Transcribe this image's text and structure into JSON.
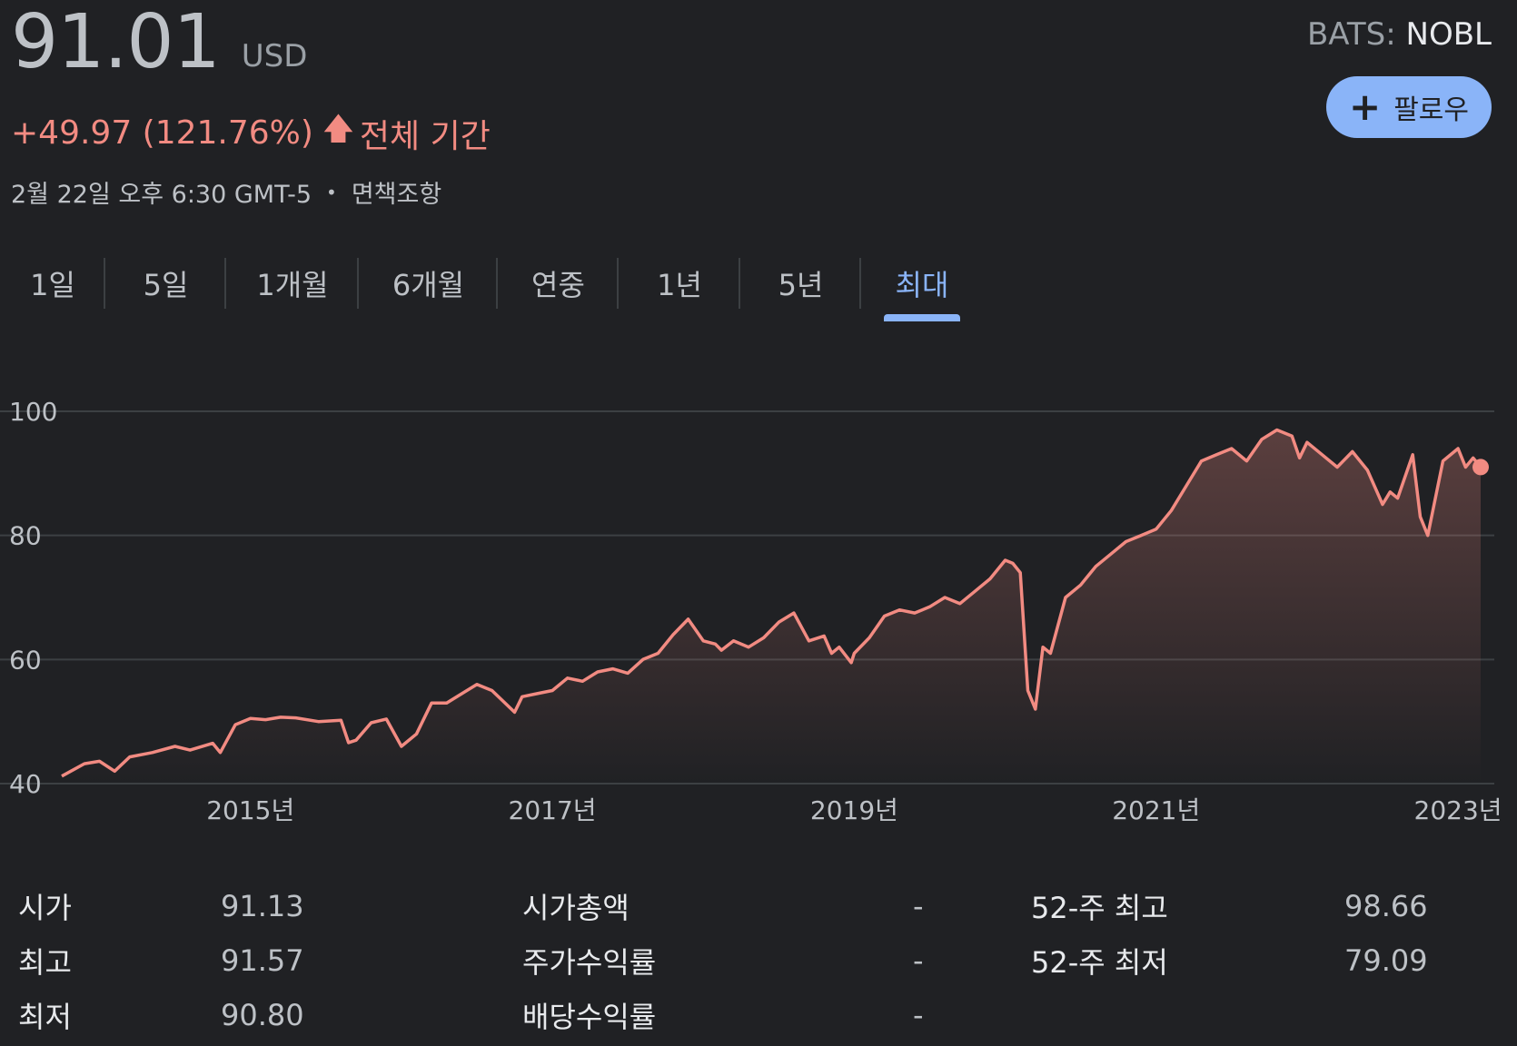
{
  "quote": {
    "price": "91.01",
    "currency": "USD",
    "exchange": "BATS:",
    "symbol": "NOBL",
    "change": "+49.97 (121.76%)",
    "period": "전체 기간",
    "timestamp": "2월 22일 오후 6:30 GMT-5",
    "disclaimer": "면책조항",
    "follow_label": "팔로우",
    "up_color": "#f28b82"
  },
  "tabs": [
    {
      "label": "1일",
      "active": false
    },
    {
      "label": "5일",
      "active": false
    },
    {
      "label": "1개월",
      "active": false
    },
    {
      "label": "6개월",
      "active": false
    },
    {
      "label": "연중",
      "active": false
    },
    {
      "label": "1년",
      "active": false
    },
    {
      "label": "5년",
      "active": false
    },
    {
      "label": "최대",
      "active": true
    }
  ],
  "chart_data": {
    "type": "area",
    "title": "",
    "xlabel": "",
    "ylabel": "",
    "x_ticks": [
      "2015년",
      "2017년",
      "2019년",
      "2021년",
      "2023년"
    ],
    "y_ticks": [
      40,
      60,
      80,
      100
    ],
    "ylim": [
      40,
      100
    ],
    "xlim": [
      2013.75,
      2023.15
    ],
    "grid": true,
    "line_color": "#f28b82",
    "series": [
      {
        "x": [
          2013.75,
          2013.9,
          2014.0,
          2014.1,
          2014.2,
          2014.35,
          2014.5,
          2014.6,
          2014.75,
          2014.8,
          2014.9,
          2015.0,
          2015.1,
          2015.2,
          2015.3,
          2015.45,
          2015.6,
          2015.65,
          2015.7,
          2015.8,
          2015.9,
          2016.0,
          2016.1,
          2016.2,
          2016.3,
          2016.5,
          2016.6,
          2016.75,
          2016.8,
          2016.9,
          2017.0,
          2017.1,
          2017.2,
          2017.3,
          2017.4,
          2017.5,
          2017.6,
          2017.7,
          2017.8,
          2017.9,
          2018.0,
          2018.08,
          2018.12,
          2018.2,
          2018.3,
          2018.4,
          2018.5,
          2018.6,
          2018.7,
          2018.8,
          2018.85,
          2018.9,
          2018.98,
          2019.0,
          2019.1,
          2019.2,
          2019.3,
          2019.4,
          2019.5,
          2019.6,
          2019.7,
          2019.8,
          2019.9,
          2020.0,
          2020.05,
          2020.1,
          2020.15,
          2020.2,
          2020.25,
          2020.3,
          2020.4,
          2020.5,
          2020.6,
          2020.7,
          2020.8,
          2020.9,
          2021.0,
          2021.1,
          2021.2,
          2021.3,
          2021.4,
          2021.5,
          2021.6,
          2021.7,
          2021.8,
          2021.9,
          2021.95,
          2022.0,
          2022.1,
          2022.2,
          2022.3,
          2022.4,
          2022.5,
          2022.55,
          2022.6,
          2022.7,
          2022.75,
          2022.8,
          2022.9,
          2023.0,
          2023.05,
          2023.1,
          2023.15
        ],
        "values": [
          41.2,
          43.2,
          43.6,
          42.0,
          44.3,
          45.0,
          46.0,
          45.4,
          46.5,
          45.0,
          49.5,
          50.5,
          50.3,
          50.7,
          50.6,
          50.0,
          50.2,
          46.6,
          47.0,
          49.8,
          50.4,
          46.0,
          48.0,
          53.0,
          53.0,
          56.0,
          55.0,
          51.5,
          54.0,
          54.5,
          55.0,
          57.0,
          56.5,
          58.0,
          58.5,
          57.8,
          60.0,
          61.0,
          64.0,
          66.5,
          63.0,
          62.5,
          61.5,
          63.0,
          62.0,
          63.5,
          66.0,
          67.5,
          63.0,
          63.8,
          61.0,
          62.0,
          59.5,
          61.0,
          63.5,
          67.0,
          68.0,
          67.5,
          68.5,
          70.0,
          69.0,
          71.0,
          73.0,
          76.0,
          75.5,
          74.0,
          55.0,
          52.0,
          62.0,
          61.0,
          70.0,
          72.0,
          75.0,
          77.0,
          79.0,
          80.0,
          81.0,
          84.0,
          88.0,
          92.0,
          93.0,
          94.0,
          92.0,
          95.5,
          97.0,
          96.0,
          92.5,
          95.0,
          93.0,
          91.0,
          93.5,
          90.5,
          85.0,
          87.0,
          86.0,
          93.0,
          83.0,
          80.0,
          92.0,
          94.0,
          91.0,
          92.5,
          91.01
        ]
      }
    ]
  },
  "stats": {
    "rows": [
      {
        "l1": "시가",
        "v1": "91.13",
        "l2": "시가총액",
        "v2": "-",
        "l3": "52-주 최고",
        "v3": "98.66"
      },
      {
        "l1": "최고",
        "v1": "91.57",
        "l2": "주가수익률",
        "v2": "-",
        "l3": "52-주 최저",
        "v3": "79.09"
      },
      {
        "l1": "최저",
        "v1": "90.80",
        "l2": "배당수익률",
        "v2": "-",
        "l3": "",
        "v3": ""
      }
    ]
  }
}
